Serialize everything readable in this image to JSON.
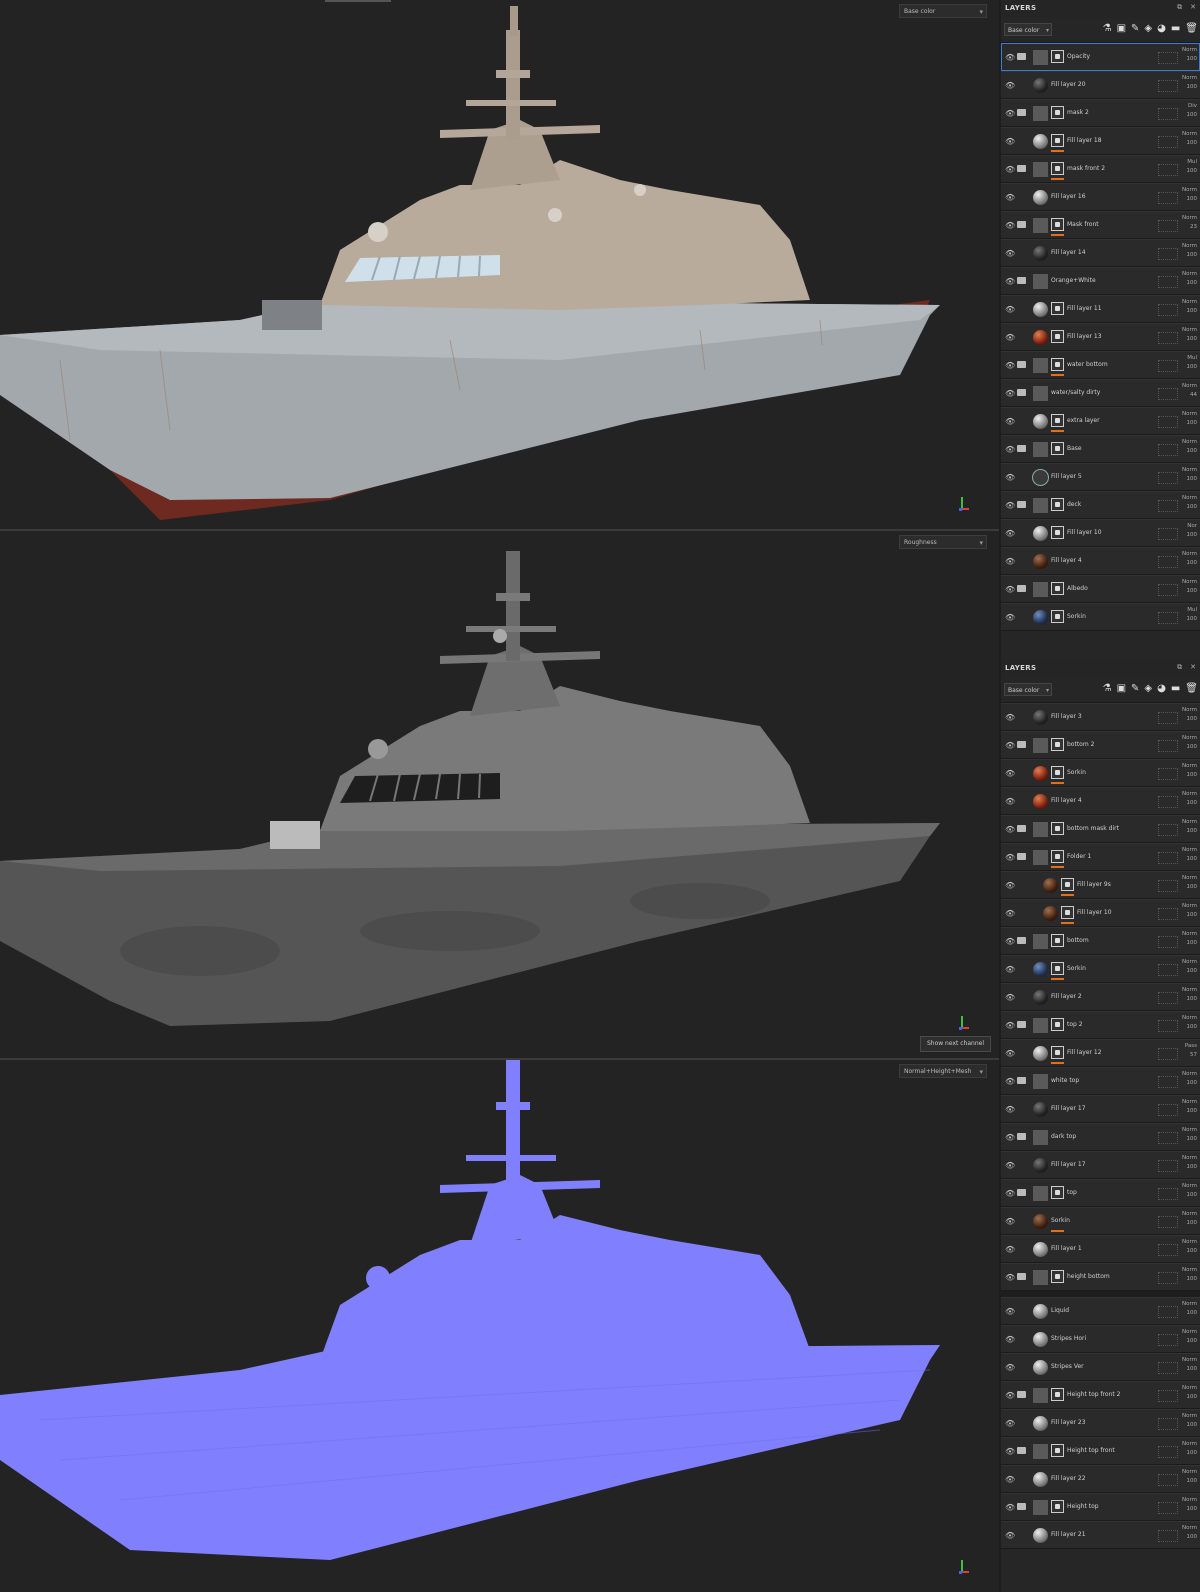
{
  "viewports": [
    {
      "channel": "Base color"
    },
    {
      "channel": "Roughness",
      "tooltip": "Show next channel"
    },
    {
      "channel": "Normal+Height+Mesh"
    }
  ],
  "colors": {
    "hull_gray": "#a3a8ad",
    "superstructure": "#b9ab9c",
    "bottom_red": "#6e2a20",
    "normal_purple": "#8080ff",
    "accent_orange": "#e07020"
  },
  "panel1": {
    "title": "LAYERS",
    "channel": "Base color",
    "layers": [
      {
        "name": "Opacity",
        "type": "folder",
        "mask": true,
        "blend": "Norm",
        "value": "100",
        "selected": true
      },
      {
        "name": "Fill layer 20",
        "type": "fill",
        "thumb": "dark",
        "mask": false,
        "blend": "Norm",
        "value": "100"
      },
      {
        "name": "mask 2",
        "type": "folder",
        "mask": true,
        "blend": "Div",
        "value": "100"
      },
      {
        "name": "Fill layer 18",
        "type": "fill",
        "thumb": "sphere",
        "mask": true,
        "bar": true,
        "blend": "Norm",
        "value": "100"
      },
      {
        "name": "mask front 2",
        "type": "folder",
        "mask": true,
        "bar": true,
        "blend": "Mul",
        "value": "100"
      },
      {
        "name": "Fill layer 16",
        "type": "fill",
        "thumb": "sphere",
        "mask": false,
        "blend": "Norm",
        "value": "100"
      },
      {
        "name": "Mask front",
        "type": "folder",
        "mask": true,
        "bar": true,
        "blend": "Norm",
        "value": "23"
      },
      {
        "name": "Fill layer 14",
        "type": "fill",
        "thumb": "dark",
        "mask": false,
        "blend": "Norm",
        "value": "100"
      },
      {
        "name": "Orange+White",
        "type": "folder",
        "mask": false,
        "blend": "Norm",
        "value": "100"
      },
      {
        "name": "Fill layer 11",
        "type": "fill",
        "thumb": "sphere",
        "mask": true,
        "blend": "Norm",
        "value": "100"
      },
      {
        "name": "Fill layer 13",
        "type": "fill",
        "thumb": "rust",
        "mask": true,
        "blend": "Norm",
        "value": "100"
      },
      {
        "name": "water bottom",
        "type": "folder",
        "mask": true,
        "bar": true,
        "blend": "Mul",
        "value": "100"
      },
      {
        "name": "water/salty dirty",
        "type": "folder",
        "mask": false,
        "blend": "Norm",
        "value": "44"
      },
      {
        "name": "extra layer",
        "type": "fill",
        "thumb": "sphere",
        "mask": true,
        "bar": true,
        "blend": "Norm",
        "value": "100"
      },
      {
        "name": "Base",
        "type": "folder",
        "mask": true,
        "blend": "Norm",
        "value": "100"
      },
      {
        "name": "Fill layer 5",
        "type": "fill",
        "thumb": "wire",
        "mask": false,
        "blend": "Norm",
        "value": "100"
      },
      {
        "name": "deck",
        "type": "folder",
        "mask": true,
        "blend": "Norm",
        "value": "100"
      },
      {
        "name": "Fill layer 10",
        "type": "fill",
        "thumb": "sphere",
        "mask": true,
        "blend": "Nor",
        "value": "100"
      },
      {
        "name": "Fill layer 4",
        "type": "fill",
        "thumb": "brown",
        "mask": false,
        "blend": "Norm",
        "value": "100"
      },
      {
        "name": "Albedo",
        "type": "folder",
        "mask": true,
        "blend": "Norm",
        "value": "100"
      },
      {
        "name": "Sorkin",
        "type": "fill",
        "thumb": "blue",
        "mask": true,
        "blend": "Mul",
        "value": "100"
      }
    ]
  },
  "panel2": {
    "title": "LAYERS",
    "channel": "Base color",
    "layers": [
      {
        "name": "Fill layer 3",
        "type": "fill",
        "thumb": "dark",
        "mask": false,
        "blend": "Norm",
        "value": "100"
      },
      {
        "name": "bottom 2",
        "type": "folder",
        "mask": true,
        "blend": "Norm",
        "value": "100"
      },
      {
        "name": "Sorkin",
        "type": "fill",
        "thumb": "rust",
        "mask": true,
        "bar": true,
        "blend": "Norm",
        "value": "100"
      },
      {
        "name": "Fill layer 4",
        "type": "fill",
        "thumb": "rust",
        "mask": false,
        "blend": "Norm",
        "value": "100"
      },
      {
        "name": "bottom mask dirt",
        "type": "folder",
        "mask": true,
        "blend": "Norm",
        "value": "100"
      },
      {
        "name": "Folder 1",
        "type": "folder",
        "mask": true,
        "bar": true,
        "blend": "Norm",
        "value": "100"
      },
      {
        "name": "Fill layer 9s",
        "type": "fill",
        "thumb": "brown",
        "mask": true,
        "bar": true,
        "indent": true,
        "blend": "Norm",
        "value": "100"
      },
      {
        "name": "Fill layer 10",
        "type": "fill",
        "thumb": "brown",
        "mask": true,
        "bar": true,
        "indent": true,
        "blend": "Norm",
        "value": "100"
      },
      {
        "name": "bottom",
        "type": "folder",
        "mask": true,
        "blend": "Norm",
        "value": "100"
      },
      {
        "name": "Sorkin",
        "type": "fill",
        "thumb": "blue",
        "mask": true,
        "bar": true,
        "blend": "Norm",
        "value": "100"
      },
      {
        "name": "Fill layer 2",
        "type": "fill",
        "thumb": "dark",
        "mask": false,
        "blend": "Norm",
        "value": "100"
      },
      {
        "name": "top 2",
        "type": "folder",
        "mask": true,
        "blend": "Norm",
        "value": "100"
      },
      {
        "name": "Fill layer 12",
        "type": "fill",
        "thumb": "sphere",
        "mask": true,
        "bar": true,
        "blend": "Pass",
        "value": "57"
      },
      {
        "name": "white top",
        "type": "folder",
        "mask": false,
        "blend": "Norm",
        "value": "100"
      },
      {
        "name": "Fill layer 17",
        "type": "fill",
        "thumb": "dark",
        "mask": false,
        "blend": "Norm",
        "value": "100"
      },
      {
        "name": "dark top",
        "type": "folder",
        "mask": false,
        "blend": "Norm",
        "value": "100"
      },
      {
        "name": "Fill layer 17",
        "type": "fill",
        "thumb": "dark",
        "mask": false,
        "blend": "Norm",
        "value": "100"
      },
      {
        "name": "top",
        "type": "folder",
        "mask": true,
        "blend": "Norm",
        "value": "100"
      },
      {
        "name": "Sorkin",
        "type": "fill",
        "thumb": "brown",
        "mask": false,
        "bar": true,
        "blend": "Norm",
        "value": "100"
      },
      {
        "name": "Fill layer 1",
        "type": "fill",
        "thumb": "sphere",
        "mask": false,
        "blend": "Norm",
        "value": "100"
      },
      {
        "name": "height bottom",
        "type": "folder",
        "mask": true,
        "blend": "Norm",
        "value": "100"
      }
    ],
    "layers_lower": [
      {
        "name": "Liquid",
        "type": "fill",
        "thumb": "sphere",
        "mask": false,
        "blend": "Norm",
        "value": "100"
      },
      {
        "name": "Stripes Hori",
        "type": "fill",
        "thumb": "sphere",
        "mask": false,
        "blend": "Norm",
        "value": "100"
      },
      {
        "name": "Stripes Ver",
        "type": "fill",
        "thumb": "sphere",
        "mask": false,
        "blend": "Norm",
        "value": "100"
      },
      {
        "name": "Height top front 2",
        "type": "folder",
        "mask": true,
        "blend": "Norm",
        "value": "100"
      },
      {
        "name": "Fill layer 23",
        "type": "fill",
        "thumb": "sphere",
        "mask": false,
        "blend": "Norm",
        "value": "100"
      },
      {
        "name": "Height top front",
        "type": "folder",
        "mask": true,
        "blend": "Norm",
        "value": "100"
      },
      {
        "name": "Fill layer 22",
        "type": "fill",
        "thumb": "sphere",
        "mask": false,
        "blend": "Norm",
        "value": "100"
      },
      {
        "name": "Height top",
        "type": "folder",
        "mask": true,
        "blend": "Norm",
        "value": "100"
      },
      {
        "name": "Fill layer 21",
        "type": "fill",
        "thumb": "sphere",
        "mask": false,
        "blend": "Norm",
        "value": "100"
      }
    ]
  }
}
